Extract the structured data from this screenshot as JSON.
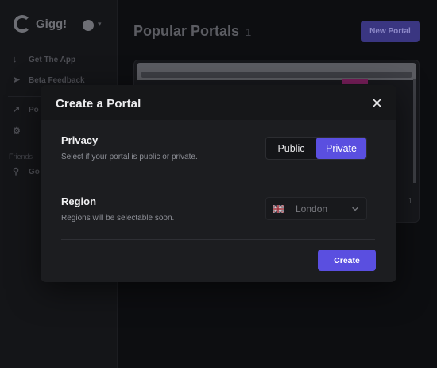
{
  "app": {
    "logo_text": "Gigg!",
    "nav": [
      {
        "label": "Get The App",
        "icon": "download-icon"
      },
      {
        "label": "Beta Feedback",
        "icon": "send-icon"
      },
      {
        "label": "Po",
        "icon": "trending-icon"
      },
      {
        "label": "",
        "icon": "cog-icon"
      }
    ],
    "friends_label": "Friends",
    "search_label": "Go",
    "page_title": "Popular Portals",
    "page_count": "1",
    "new_portal_label": "New Portal",
    "card_meta": "1"
  },
  "modal": {
    "title": "Create a Portal",
    "privacy": {
      "title": "Privacy",
      "description": "Select if your portal is public or private.",
      "options": [
        "Public",
        "Private"
      ],
      "selected": "Private"
    },
    "region": {
      "title": "Region",
      "description": "Regions will be selectable soon.",
      "value": "London",
      "flag_icon": "uk-flag-icon"
    },
    "create_label": "Create"
  },
  "colors": {
    "accent": "#5a4fe0",
    "modal_bg": "#1c1d20",
    "header_bg": "#161719"
  }
}
